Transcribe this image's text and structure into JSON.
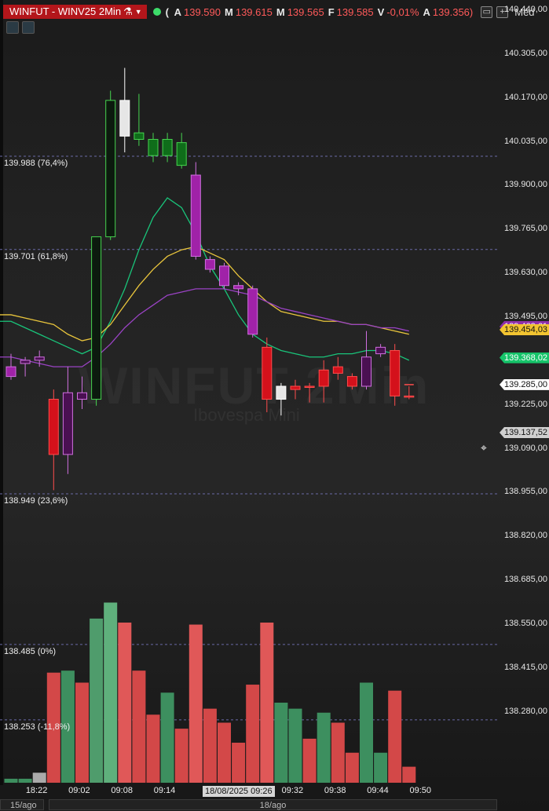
{
  "header": {
    "symbol_label": "WINFUT - WINV25 2Min",
    "symbol_icon": "flask-icon",
    "ohlc": [
      {
        "label": "A",
        "value": "139.590"
      },
      {
        "label": "M",
        "value": "139.615"
      },
      {
        "label": "M",
        "value": "139.565"
      },
      {
        "label": "F",
        "value": "139.585"
      },
      {
        "label": "V",
        "value": "-0,01%"
      },
      {
        "label": "A",
        "value": "139.356)"
      }
    ],
    "ohlc_open_paren": "(",
    "media_label": "Méd",
    "colors": {
      "symbol_bg": "#b3161b",
      "live_dot": "#3ddc6a",
      "value": "#ff5a5a"
    }
  },
  "price_axis": {
    "ticks": [
      "140.440,00",
      "140.305,00",
      "140.170,00",
      "140.035,00",
      "139.900,00",
      "139.765,00",
      "139.630,00",
      "139.495,00",
      "139.225,00",
      "139.090,00",
      "138.955,00",
      "138.820,00",
      "138.685,00",
      "138.550,00",
      "138.415,00",
      "138.280,00"
    ],
    "ylim": [
      138.19,
      140.44
    ],
    "tags": [
      {
        "text": "139.463,61",
        "price": 139.4636,
        "bg": "#8e2fa8",
        "fg": "#ffffff"
      },
      {
        "text": "139.454,03",
        "price": 139.454,
        "bg": "#f2c431",
        "fg": "#111111"
      },
      {
        "text": "139.368,02",
        "price": 139.368,
        "bg": "#16c46a",
        "fg": "#ffffff"
      },
      {
        "text": "139.285,00",
        "price": 139.285,
        "bg": "#ffffff",
        "fg": "#111111"
      },
      {
        "text": "139.137,52",
        "price": 139.1375,
        "bg": "#cfcfcf",
        "fg": "#111111"
      }
    ]
  },
  "fib_levels": [
    {
      "label": "139.988 (76,4%)",
      "price": 139.988
    },
    {
      "label": "139.701 (61,8%)",
      "price": 139.701
    },
    {
      "label": "138.949 (23,6%)",
      "price": 138.949
    },
    {
      "label": "138.485 (0%)",
      "price": 138.485
    },
    {
      "label": "138.253 (-11,8%)",
      "price": 138.253
    }
  ],
  "watermark": {
    "title": "WINFUT 2Min",
    "subtitle": "Ibovespa Mini"
  },
  "time_axis": {
    "labels": [
      "18:22",
      "09:02",
      "09:08",
      "09:14",
      "09:32",
      "09:38",
      "09:44",
      "09:50"
    ],
    "crosshair_time": "18/08/2025 09:26",
    "date_labels": [
      "15/ago",
      "18/ago"
    ]
  },
  "chart_data": {
    "type": "candlestick",
    "candles": [
      {
        "o": 139.34,
        "h": 139.38,
        "l": 139.3,
        "c": 139.31,
        "color": "purple"
      },
      {
        "o": 139.35,
        "h": 139.37,
        "l": 139.31,
        "c": 139.36,
        "color": "purple"
      },
      {
        "o": 139.36,
        "h": 139.39,
        "l": 139.34,
        "c": 139.37,
        "color": "purple"
      },
      {
        "o": 139.24,
        "h": 139.27,
        "l": 138.96,
        "c": 139.07,
        "color": "red"
      },
      {
        "o": 139.07,
        "h": 139.34,
        "l": 139.01,
        "c": 139.26,
        "color": "purple"
      },
      {
        "o": 139.24,
        "h": 139.31,
        "l": 139.21,
        "c": 139.26,
        "color": "purple"
      },
      {
        "o": 139.24,
        "h": 139.74,
        "l": 139.22,
        "c": 139.74,
        "color": "green"
      },
      {
        "o": 139.74,
        "h": 140.19,
        "l": 139.73,
        "c": 140.16,
        "color": "green"
      },
      {
        "o": 140.05,
        "h": 140.26,
        "l": 140.0,
        "c": 140.16,
        "color": "white"
      },
      {
        "o": 140.06,
        "h": 140.18,
        "l": 140.02,
        "c": 140.04,
        "color": "green"
      },
      {
        "o": 140.04,
        "h": 140.06,
        "l": 139.97,
        "c": 139.99,
        "color": "green"
      },
      {
        "o": 139.99,
        "h": 140.06,
        "l": 139.97,
        "c": 140.04,
        "color": "green"
      },
      {
        "o": 140.03,
        "h": 140.06,
        "l": 139.95,
        "c": 139.96,
        "color": "green"
      },
      {
        "o": 139.93,
        "h": 139.97,
        "l": 139.67,
        "c": 139.68,
        "color": "purple"
      },
      {
        "o": 139.67,
        "h": 139.68,
        "l": 139.63,
        "c": 139.64,
        "color": "purple"
      },
      {
        "o": 139.65,
        "h": 139.66,
        "l": 139.58,
        "c": 139.59,
        "color": "purple"
      },
      {
        "o": 139.59,
        "h": 139.6,
        "l": 139.56,
        "c": 139.58,
        "color": "purple"
      },
      {
        "o": 139.58,
        "h": 139.59,
        "l": 139.43,
        "c": 139.44,
        "color": "purple"
      },
      {
        "o": 139.4,
        "h": 139.43,
        "l": 139.2,
        "c": 139.24,
        "color": "red"
      },
      {
        "o": 139.24,
        "h": 139.29,
        "l": 139.19,
        "c": 139.28,
        "color": "white"
      },
      {
        "o": 139.28,
        "h": 139.3,
        "l": 139.24,
        "c": 139.27,
        "color": "red"
      },
      {
        "o": 139.28,
        "h": 139.29,
        "l": 139.23,
        "c": 139.28,
        "color": "red"
      },
      {
        "o": 139.33,
        "h": 139.36,
        "l": 139.23,
        "c": 139.28,
        "color": "red"
      },
      {
        "o": 139.34,
        "h": 139.37,
        "l": 139.3,
        "c": 139.32,
        "color": "red"
      },
      {
        "o": 139.31,
        "h": 139.32,
        "l": 139.27,
        "c": 139.28,
        "color": "red"
      },
      {
        "o": 139.28,
        "h": 139.45,
        "l": 139.27,
        "c": 139.37,
        "color": "purple"
      },
      {
        "o": 139.38,
        "h": 139.41,
        "l": 139.37,
        "c": 139.4,
        "color": "purple"
      },
      {
        "o": 139.39,
        "h": 139.41,
        "l": 139.22,
        "c": 139.25,
        "color": "red"
      },
      {
        "o": 139.25,
        "h": 139.28,
        "l": 139.24,
        "c": 139.25,
        "color": "red"
      }
    ],
    "volume": [
      {
        "v": 0.02,
        "c": "green"
      },
      {
        "v": 0.02,
        "c": "green"
      },
      {
        "v": 0.05,
        "c": "white"
      },
      {
        "v": 0.55,
        "c": "red"
      },
      {
        "v": 0.56,
        "c": "green"
      },
      {
        "v": 0.5,
        "c": "red"
      },
      {
        "v": 0.82,
        "c": "green"
      },
      {
        "v": 0.9,
        "c": "green"
      },
      {
        "v": 0.8,
        "c": "red"
      },
      {
        "v": 0.56,
        "c": "red"
      },
      {
        "v": 0.34,
        "c": "red"
      },
      {
        "v": 0.45,
        "c": "green"
      },
      {
        "v": 0.27,
        "c": "red"
      },
      {
        "v": 0.79,
        "c": "red"
      },
      {
        "v": 0.37,
        "c": "red"
      },
      {
        "v": 0.3,
        "c": "red"
      },
      {
        "v": 0.2,
        "c": "red"
      },
      {
        "v": 0.49,
        "c": "red"
      },
      {
        "v": 0.8,
        "c": "red"
      },
      {
        "v": 0.4,
        "c": "green"
      },
      {
        "v": 0.37,
        "c": "green"
      },
      {
        "v": 0.22,
        "c": "red"
      },
      {
        "v": 0.35,
        "c": "green"
      },
      {
        "v": 0.3,
        "c": "red"
      },
      {
        "v": 0.15,
        "c": "red"
      },
      {
        "v": 0.5,
        "c": "green"
      },
      {
        "v": 0.15,
        "c": "green"
      },
      {
        "v": 0.46,
        "c": "red"
      },
      {
        "v": 0.08,
        "c": "red"
      }
    ],
    "moving_averages": [
      {
        "color": "#19c47a",
        "values": [
          139.48,
          139.46,
          139.44,
          139.42,
          139.4,
          139.38,
          139.4,
          139.48,
          139.58,
          139.7,
          139.8,
          139.86,
          139.83,
          139.75,
          139.65,
          139.58,
          139.5,
          139.44,
          139.41,
          139.39,
          139.38,
          139.37,
          139.37,
          139.38,
          139.38,
          139.39,
          139.39,
          139.38,
          139.36
        ]
      },
      {
        "color": "#e9c53c",
        "values": [
          139.5,
          139.49,
          139.48,
          139.47,
          139.44,
          139.42,
          139.43,
          139.47,
          139.53,
          139.59,
          139.64,
          139.68,
          139.7,
          139.71,
          139.69,
          139.67,
          139.62,
          139.58,
          139.54,
          139.51,
          139.5,
          139.49,
          139.48,
          139.48,
          139.47,
          139.47,
          139.46,
          139.45,
          139.44
        ]
      },
      {
        "color": "#9a43c4",
        "values": [
          139.37,
          139.36,
          139.35,
          139.34,
          139.34,
          139.34,
          139.37,
          139.41,
          139.46,
          139.5,
          139.53,
          139.56,
          139.57,
          139.58,
          139.58,
          139.58,
          139.57,
          139.56,
          139.54,
          139.52,
          139.51,
          139.5,
          139.49,
          139.48,
          139.47,
          139.47,
          139.46,
          139.46,
          139.45
        ]
      }
    ]
  }
}
